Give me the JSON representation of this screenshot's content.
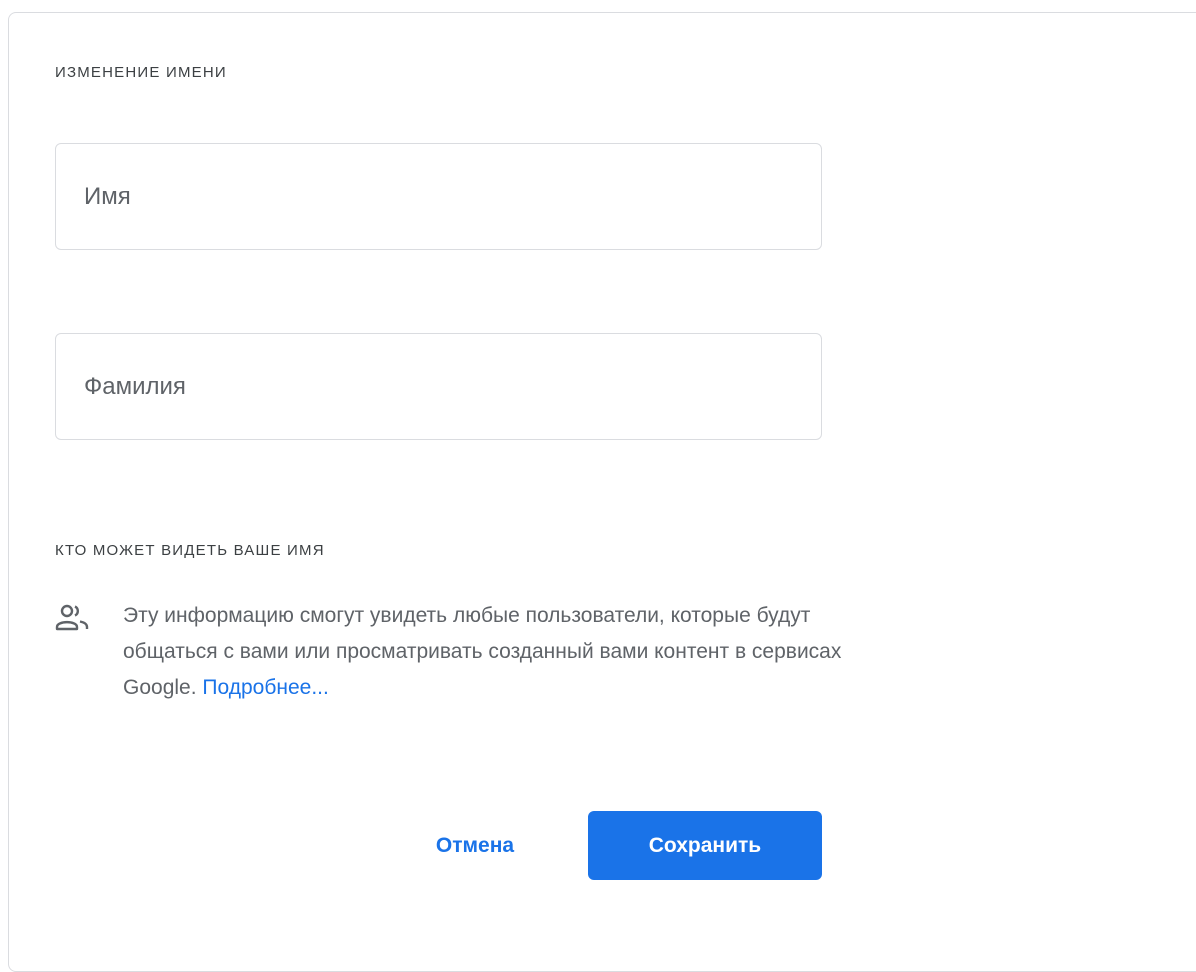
{
  "name_section": {
    "title": "ИЗМЕНЕНИЕ ИМЕНИ",
    "first_name_placeholder": "Имя",
    "last_name_placeholder": "Фамилия"
  },
  "visibility_section": {
    "title": "КТО МОЖЕТ ВИДЕТЬ ВАШЕ ИМЯ",
    "icon": "people-icon",
    "description": "Эту информацию смогут увидеть любые пользователи, которые будут общаться с вами или просматривать созданный вами контент в сервисах Google.",
    "learn_more_link": "Подробнее..."
  },
  "actions": {
    "cancel_label": "Отмена",
    "save_label": "Сохранить"
  },
  "colors": {
    "accent": "#1a73e8",
    "text_secondary": "#5f6368",
    "border": "#dadce0"
  }
}
